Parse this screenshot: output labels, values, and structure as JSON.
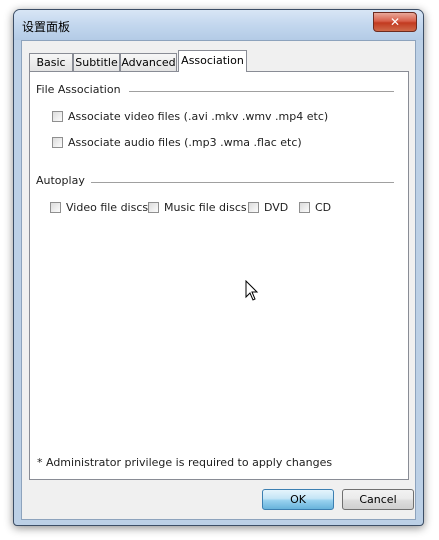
{
  "window": {
    "title": "设置面板",
    "close_label": "✕"
  },
  "tabs": [
    {
      "label": "Basic",
      "active": false
    },
    {
      "label": "Subtitle",
      "active": false
    },
    {
      "label": "Advanced",
      "active": false
    },
    {
      "label": "Association",
      "active": true
    }
  ],
  "file_association": {
    "heading": "File Association",
    "video_label": "Associate video files (.avi .mkv .wmv .mp4 etc)",
    "video_checked": false,
    "audio_label": "Associate audio files (.mp3 .wma .flac etc)",
    "audio_checked": false
  },
  "autoplay": {
    "heading": "Autoplay",
    "items": [
      {
        "label": "Video file discs",
        "checked": false
      },
      {
        "label": "Music file discs",
        "checked": false
      },
      {
        "label": "DVD",
        "checked": false
      },
      {
        "label": "CD",
        "checked": false
      }
    ]
  },
  "note": "* Administrator privilege is required to apply changes",
  "buttons": {
    "ok": "OK",
    "cancel": "Cancel"
  },
  "icons": {
    "close": "close-icon",
    "cursor": "mouse-pointer-icon"
  }
}
